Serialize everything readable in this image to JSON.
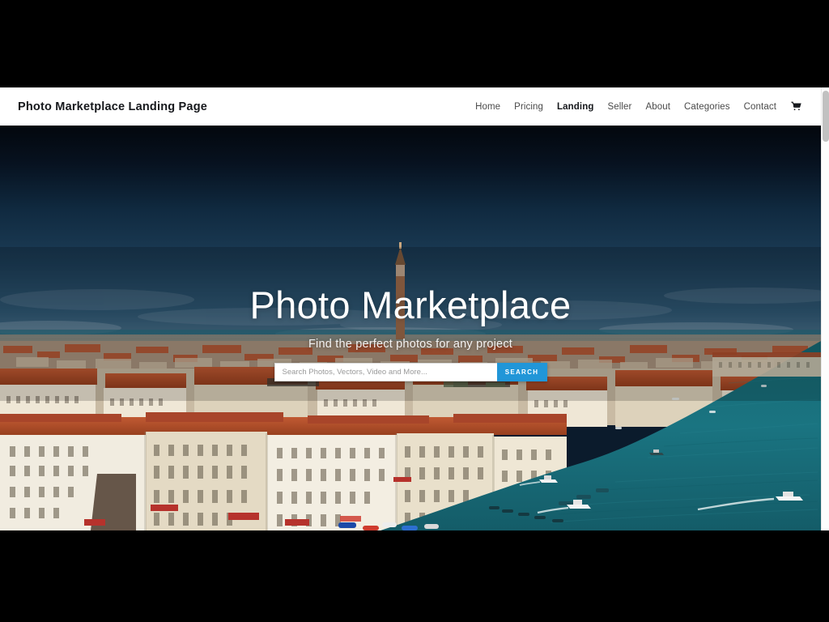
{
  "window": {
    "background_color": "#000000"
  },
  "header": {
    "brand": "Photo Marketplace Landing Page",
    "nav": [
      {
        "label": "Home",
        "active": false
      },
      {
        "label": "Pricing",
        "active": false
      },
      {
        "label": "Landing",
        "active": true
      },
      {
        "label": "Seller",
        "active": false
      },
      {
        "label": "About",
        "active": false
      },
      {
        "label": "Categories",
        "active": false
      },
      {
        "label": "Contact",
        "active": false
      }
    ],
    "cart_icon": "shopping-cart-icon"
  },
  "hero": {
    "title": "Photo Marketplace",
    "subtitle": "Find the perfect photos for any project",
    "search": {
      "value": "",
      "placeholder": "Search Photos, Vectors, Video and More...",
      "button_label": "SEARCH",
      "button_color": "#2196d8"
    },
    "background_image": {
      "description": "Aerial photograph of Venice waterfront with terracotta rooftops and teal lagoon",
      "sky_top_color": "#050a12",
      "sky_bottom_color": "#2b4a68",
      "water_color": "#1b6f7c",
      "roof_color": "#b24a2a",
      "building_color": "#e6ddcb"
    }
  },
  "scrollbar": {
    "thumb_color": "#c1c1c1",
    "track_color": "#fdfdfd"
  }
}
